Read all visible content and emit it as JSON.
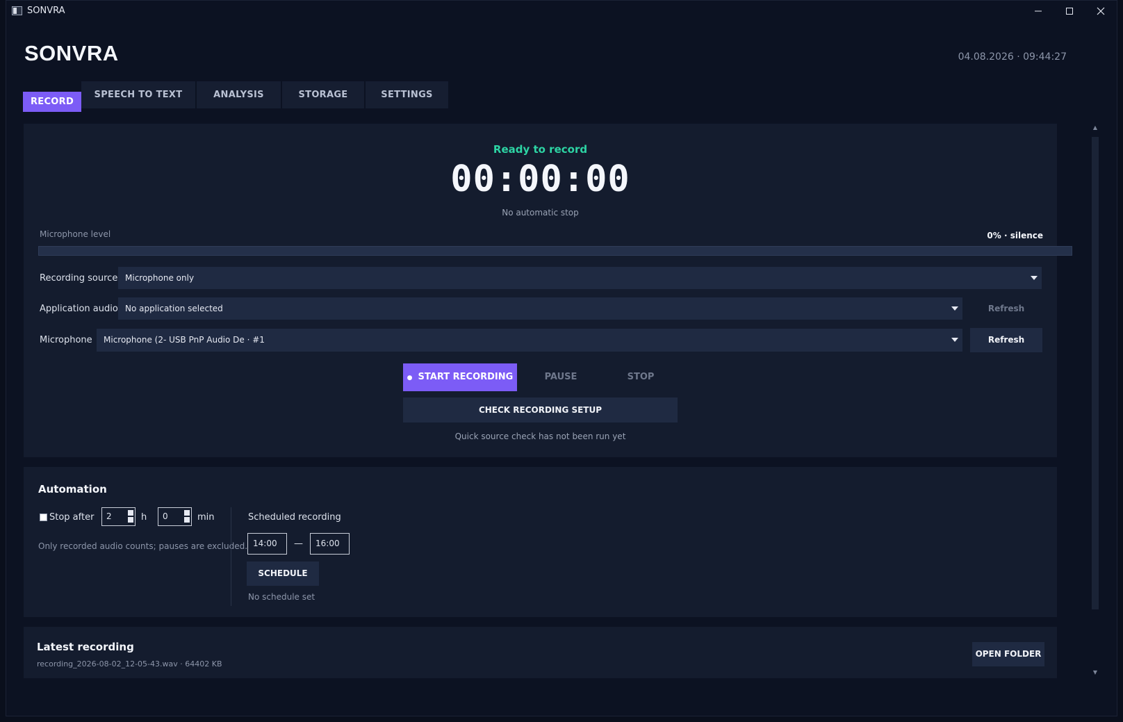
{
  "window": {
    "title": "SONVRA",
    "minimize_label": "—",
    "maximize_label": "☐",
    "close_label": "✕"
  },
  "header": {
    "brand": "SONVRA",
    "datetime": "04.08.2026  ·  09:44:27"
  },
  "tabs": [
    {
      "label": "RECORD",
      "active": true
    },
    {
      "label": "SPEECH TO TEXT",
      "active": false
    },
    {
      "label": "ANALYSIS",
      "active": false
    },
    {
      "label": "STORAGE",
      "active": false
    },
    {
      "label": "SETTINGS",
      "active": false
    }
  ],
  "record": {
    "status": "Ready to record",
    "timer": "00:00:00",
    "auto_stop": "No automatic stop",
    "mic_level_label": "Microphone level",
    "mic_level_value": "0% · silence",
    "mic_level_fraction": 0,
    "recording_source_label": "Recording source",
    "recording_source_value": "Microphone only",
    "app_audio_label": "Application audio",
    "app_audio_value": "No application selected",
    "app_audio_refresh": "Refresh",
    "microphone_label": "Microphone",
    "microphone_value": "Microphone (2- USB PnP Audio De  ·  #1",
    "microphone_refresh": "Refresh",
    "start_label": "START RECORDING",
    "start_bullet": "●",
    "pause_label": "PAUSE",
    "stop_label": "STOP",
    "check_setup_label": "CHECK RECORDING SETUP",
    "check_status": "Quick source check has not been run yet"
  },
  "automation": {
    "title": "Automation",
    "stop_after_label": "Stop after",
    "stop_after_checked": false,
    "hours_value": "2",
    "hours_unit": "h",
    "minutes_value": "0",
    "minutes_unit": "min",
    "note": "Only recorded audio counts; pauses are excluded.",
    "scheduled_label": "Scheduled recording",
    "start_time": "14:00",
    "dash": "—",
    "end_time": "16:00",
    "schedule_button": "SCHEDULE",
    "schedule_status": "No schedule set"
  },
  "latest": {
    "title": "Latest recording",
    "file": "recording_2026-08-02_12-05-43.wav  ·  64402 KB",
    "open_folder": "OPEN FOLDER"
  },
  "colors": {
    "accent": "#7c5cf6",
    "ready": "#2dd4a4",
    "background": "#0c1222",
    "panel": "#141c2e"
  }
}
